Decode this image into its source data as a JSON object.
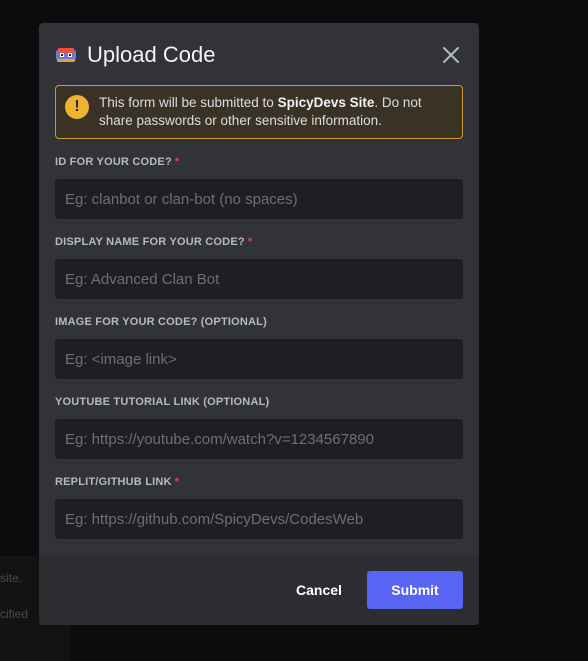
{
  "background": {
    "line1": "site.",
    "line2": "cified"
  },
  "modal": {
    "icon": "bot-app-icon",
    "title": "Upload Code",
    "close_icon": "close-icon",
    "warning": {
      "icon": "exclamation-icon",
      "prefix": "This form will be submitted to ",
      "site": "SpicyDevs Site",
      "suffix": ". Do not share passwords or other sensitive information."
    },
    "fields": [
      {
        "label": "ID FOR YOUR CODE?",
        "required": "*",
        "placeholder": "Eg: clanbot or clan-bot (no spaces)",
        "value": ""
      },
      {
        "label": "DISPLAY NAME FOR YOUR CODE?",
        "required": "*",
        "placeholder": "Eg: Advanced Clan Bot",
        "value": ""
      },
      {
        "label": "IMAGE FOR YOUR CODE? (OPTIONAL)",
        "required": "",
        "placeholder": "Eg: <image link>",
        "value": ""
      },
      {
        "label": "YOUTUBE TUTORIAL LINK (OPTIONAL)",
        "required": "",
        "placeholder": "Eg: https://youtube.com/watch?v=1234567890",
        "value": ""
      },
      {
        "label": "REPLIT/GITHUB LINK",
        "required": "*",
        "placeholder": "Eg: https://github.com/SpicyDevs/CodesWeb",
        "value": ""
      }
    ],
    "footer": {
      "cancel_label": "Cancel",
      "submit_label": "Submit"
    }
  },
  "colors": {
    "modal_bg": "#313338",
    "footer_bg": "#2b2d31",
    "input_bg": "#1e1f22",
    "warning_border": "#c99a2d",
    "warning_icon": "#f0b232",
    "required": "#f23f43",
    "submit": "#5865f2"
  }
}
